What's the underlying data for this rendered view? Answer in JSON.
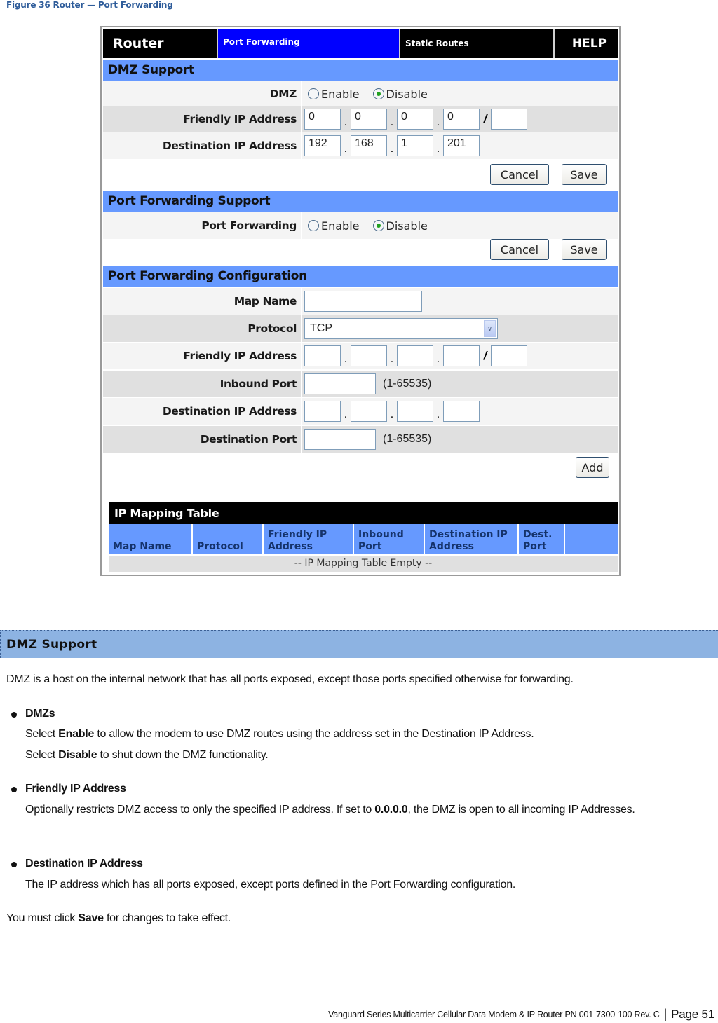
{
  "caption": "Figure 36 Router — Port Forwarding",
  "router_ui": {
    "nav": {
      "router": "Router",
      "tabs": [
        {
          "label": "Port Forwarding",
          "active": true
        },
        {
          "label": "Static Routes",
          "active": false
        }
      ],
      "help": "HELP"
    },
    "dmz_section": {
      "title": "DMZ Support",
      "dmz_label": "DMZ",
      "options": [
        "Enable",
        "Disable"
      ],
      "selected": "Disable",
      "friendly_ip_label": "Friendly IP Address",
      "friendly_ip": [
        "0",
        "0",
        "0",
        "0"
      ],
      "friendly_mask": "",
      "dest_ip_label": "Destination IP Address",
      "dest_ip": [
        "192",
        "168",
        "1",
        "201"
      ],
      "cancel": "Cancel",
      "save": "Save"
    },
    "pf_support": {
      "title": "Port Forwarding Support",
      "label": "Port Forwarding",
      "options": [
        "Enable",
        "Disable"
      ],
      "selected": "Disable",
      "cancel": "Cancel",
      "save": "Save"
    },
    "pf_config": {
      "title": "Port Forwarding Configuration",
      "map_name_label": "Map Name",
      "map_name": "",
      "protocol_label": "Protocol",
      "protocol": "TCP",
      "friendly_ip_label": "Friendly IP Address",
      "inbound_port_label": "Inbound Port",
      "inbound_range": "(1-65535)",
      "dest_ip_label": "Destination IP Address",
      "dest_port_label": "Destination Port",
      "dest_range": "(1-65535)",
      "add": "Add"
    },
    "ip_table": {
      "title": "IP Mapping Table",
      "columns": [
        "Map Name",
        "Protocol",
        "Friendly IP Address",
        "Inbound Port",
        "Destination IP Address",
        "Dest. Port",
        ""
      ],
      "empty": "-- IP Mapping Table Empty --"
    }
  },
  "doc": {
    "section_title": "DMZ Support",
    "intro": "DMZ is a host on the internal network that has all ports exposed, except those ports specified otherwise for forwarding.",
    "bullets": [
      {
        "title": "DMZs",
        "lines": [
          {
            "pre": "Select ",
            "bold": "Enable",
            "post": " to allow the modem to use DMZ routes using the address set in the Destination IP Address."
          },
          {
            "pre": "Select ",
            "bold": "Disable",
            "post": " to shut down the DMZ functionality."
          }
        ]
      },
      {
        "title": "Friendly IP Address",
        "lines": [
          {
            "pre": "Optionally restricts DMZ access to only the specified IP address. If set to ",
            "bold": "0.0.0.0",
            "post": ", the DMZ is open to all incoming IP Addresses."
          }
        ]
      },
      {
        "title": "Destination IP Address",
        "lines": [
          {
            "pre": "The IP address which has all ports exposed, except ports defined in the Port Forwarding configuration.",
            "bold": "",
            "post": ""
          }
        ]
      }
    ],
    "closing": {
      "pre": "You must click ",
      "bold": "Save",
      "post": " for changes to take effect."
    }
  },
  "footer": {
    "text": "Vanguard Series Multicarrier Cellular Data Modem & IP Router PN 001-7300-100 Rev. C",
    "separator": "|",
    "page": "Page 51"
  }
}
